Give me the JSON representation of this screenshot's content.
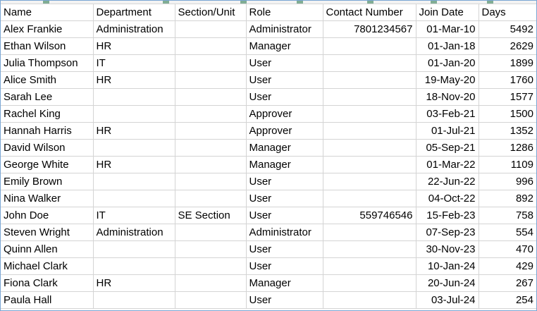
{
  "sheet": {
    "columns": [
      {
        "key": "name",
        "label": "Name",
        "align": "left"
      },
      {
        "key": "department",
        "label": "Department",
        "align": "left"
      },
      {
        "key": "section",
        "label": "Section/Unit",
        "align": "left"
      },
      {
        "key": "role",
        "label": "Role",
        "align": "left"
      },
      {
        "key": "contact",
        "label": "Contact Number",
        "align": "right"
      },
      {
        "key": "join_date",
        "label": "Join Date",
        "align": "right"
      },
      {
        "key": "days",
        "label": "Days",
        "align": "right"
      }
    ],
    "rows": [
      {
        "name": "Alex Frankie",
        "department": "Administration",
        "section": "",
        "role": "Administrator",
        "contact": "7801234567",
        "join_date": "01-Mar-10",
        "days": "5492"
      },
      {
        "name": "Ethan Wilson",
        "department": "HR",
        "section": "",
        "role": "Manager",
        "contact": "",
        "join_date": "01-Jan-18",
        "days": "2629"
      },
      {
        "name": "Julia Thompson",
        "department": "IT",
        "section": "",
        "role": "User",
        "contact": "",
        "join_date": "01-Jan-20",
        "days": "1899"
      },
      {
        "name": "Alice Smith",
        "department": "HR",
        "section": "",
        "role": "User",
        "contact": "",
        "join_date": "19-May-20",
        "days": "1760"
      },
      {
        "name": "Sarah Lee",
        "department": "",
        "section": "",
        "role": "User",
        "contact": "",
        "join_date": "18-Nov-20",
        "days": "1577"
      },
      {
        "name": "Rachel King",
        "department": "",
        "section": "",
        "role": "Approver",
        "contact": "",
        "join_date": "03-Feb-21",
        "days": "1500"
      },
      {
        "name": "Hannah Harris",
        "department": "HR",
        "section": "",
        "role": "Approver",
        "contact": "",
        "join_date": "01-Jul-21",
        "days": "1352"
      },
      {
        "name": "David Wilson",
        "department": "",
        "section": "",
        "role": "Manager",
        "contact": "",
        "join_date": "05-Sep-21",
        "days": "1286"
      },
      {
        "name": "George White",
        "department": "HR",
        "section": "",
        "role": "Manager",
        "contact": "",
        "join_date": "01-Mar-22",
        "days": "1109"
      },
      {
        "name": "Emily Brown",
        "department": "",
        "section": "",
        "role": "User",
        "contact": "",
        "join_date": "22-Jun-22",
        "days": "996"
      },
      {
        "name": "Nina Walker",
        "department": "",
        "section": "",
        "role": "User",
        "contact": "",
        "join_date": "04-Oct-22",
        "days": "892"
      },
      {
        "name": "John Doe",
        "department": "IT",
        "section": "SE Section",
        "role": "User",
        "contact": "559746546",
        "join_date": "15-Feb-23",
        "days": "758"
      },
      {
        "name": "Steven Wright",
        "department": "Administration",
        "section": "",
        "role": "Administrator",
        "contact": "",
        "join_date": "07-Sep-23",
        "days": "554"
      },
      {
        "name": "Quinn Allen",
        "department": "",
        "section": "",
        "role": "User",
        "contact": "",
        "join_date": "30-Nov-23",
        "days": "470"
      },
      {
        "name": "Michael Clark",
        "department": "",
        "section": "",
        "role": "User",
        "contact": "",
        "join_date": "10-Jan-24",
        "days": "429"
      },
      {
        "name": "Fiona Clark",
        "department": "HR",
        "section": "",
        "role": "Manager",
        "contact": "",
        "join_date": "20-Jun-24",
        "days": "267"
      },
      {
        "name": "Paula Hall",
        "department": "",
        "section": "",
        "role": "User",
        "contact": "",
        "join_date": "03-Jul-24",
        "days": "254"
      }
    ]
  },
  "colors": {
    "gridline": "#d4d4d4",
    "frame": "#7aa6d4",
    "selection_accent": "#217346"
  }
}
